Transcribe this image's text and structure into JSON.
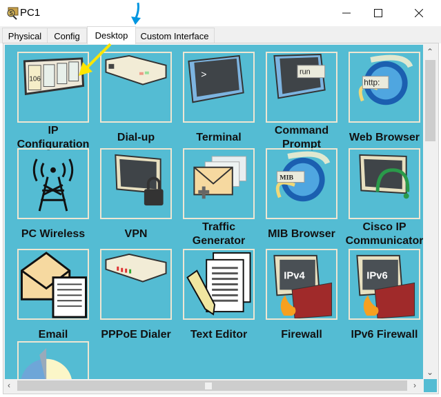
{
  "window": {
    "title": "PC1",
    "minimize_icon": "minimize-icon",
    "maximize_icon": "maximize-icon",
    "close_icon": "close-icon"
  },
  "tabs": [
    {
      "label": "Physical"
    },
    {
      "label": "Config"
    },
    {
      "label": "Desktop",
      "active": true
    },
    {
      "label": "Custom Interface"
    }
  ],
  "apps": [
    {
      "label": "IP Configuration",
      "icon": "ip-config-icon"
    },
    {
      "label": "Dial-up",
      "icon": "modem-icon"
    },
    {
      "label": "Terminal",
      "icon": "terminal-icon"
    },
    {
      "label": "Command Prompt",
      "icon": "command-prompt-icon",
      "icon_text": "run"
    },
    {
      "label": "Web Browser",
      "icon": "web-browser-icon",
      "icon_text": "http:"
    },
    {
      "label": "PC Wireless",
      "icon": "wireless-icon"
    },
    {
      "label": "VPN",
      "icon": "vpn-icon"
    },
    {
      "label": "Traffic Generator",
      "icon": "traffic-generator-icon"
    },
    {
      "label": "MIB Browser",
      "icon": "mib-browser-icon",
      "icon_text": "MIB"
    },
    {
      "label": "Cisco IP Communicator",
      "icon": "ip-communicator-icon"
    },
    {
      "label": "Email",
      "icon": "email-icon"
    },
    {
      "label": "PPPoE Dialer",
      "icon": "pppoe-icon"
    },
    {
      "label": "Text Editor",
      "icon": "text-editor-icon"
    },
    {
      "label": "Firewall",
      "icon": "firewall-icon",
      "icon_text": "IPv4"
    },
    {
      "label": "IPv6 Firewall",
      "icon": "ipv6-firewall-icon",
      "icon_text": "IPv6"
    },
    {
      "label": "",
      "icon": "pie-chart-icon"
    }
  ],
  "ip_icon_text": "106",
  "colors": {
    "desktop_bg": "#54bcd3",
    "box_border": "#efe6d2",
    "annotation_arrow_blue": "#0096e0",
    "annotation_arrow_yellow": "#ffe600"
  }
}
